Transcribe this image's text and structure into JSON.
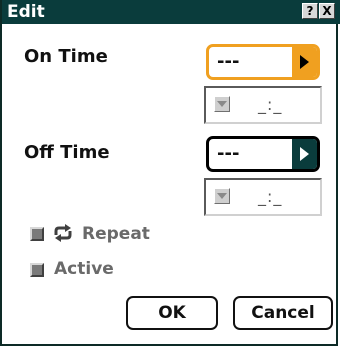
{
  "window": {
    "title": "Edit",
    "help_button": "?",
    "close_button": "X"
  },
  "on_time": {
    "label": "On Time",
    "dropdown_value": "---",
    "time_value": "_:_"
  },
  "off_time": {
    "label": "Off Time",
    "dropdown_value": "---",
    "time_value": "_:_"
  },
  "repeat": {
    "label": "Repeat",
    "icon": "repeat-arrow-icon",
    "checked": false
  },
  "active": {
    "label": "Active",
    "checked": false
  },
  "buttons": {
    "ok": "OK",
    "cancel": "Cancel"
  },
  "colors": {
    "title_bar": "#0a3c3c",
    "dropdown_highlight": "#f0a020",
    "disabled_text": "#6a6a6a"
  }
}
